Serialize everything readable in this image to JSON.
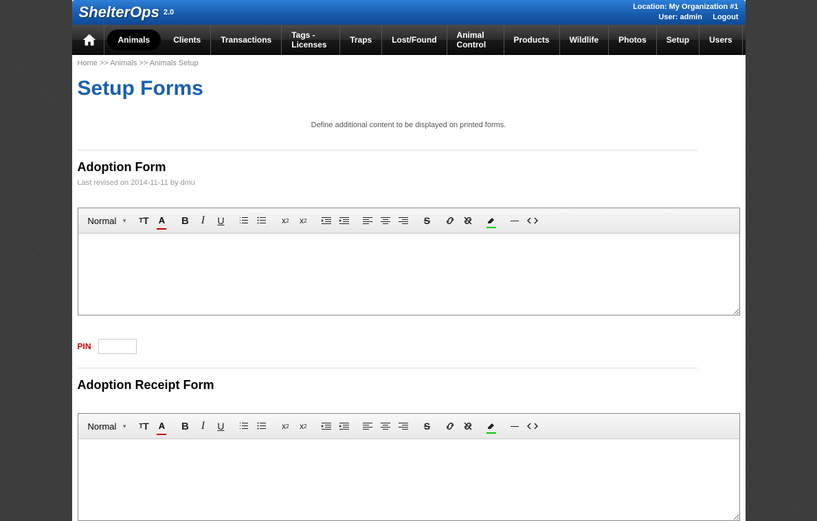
{
  "header": {
    "logo_text": "ShelterOps",
    "version": "2.0",
    "location_label": "Location:",
    "location_value": "My Organization #1",
    "user_label": "User:",
    "user_value": "admin",
    "logout": "Logout"
  },
  "nav": {
    "items": [
      "Animals",
      "Clients",
      "Transactions",
      "Tags - Licenses",
      "Traps",
      "Lost/Found",
      "Animal Control",
      "Products",
      "Wildlife",
      "Photos",
      "Setup",
      "Users"
    ],
    "active_index": 0
  },
  "breadcrumb": {
    "home": "Home",
    "sep": ">>",
    "animals": "Animals",
    "setup": "Animals Setup"
  },
  "page": {
    "title": "Setup Forms",
    "subtitle": "Define additional content to be displayed on printed forms."
  },
  "forms": {
    "adoption": {
      "heading": "Adoption Form",
      "revised": "Last revised on 2014-11-11 by dmu"
    },
    "receipt": {
      "heading": "Adoption Receipt Form"
    }
  },
  "pin": {
    "label": "PIN"
  },
  "editor": {
    "format_label": "Normal"
  }
}
